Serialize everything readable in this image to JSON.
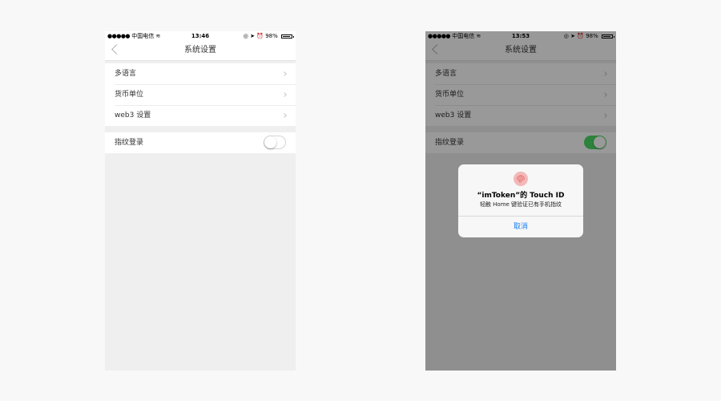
{
  "colors": {
    "page_bg": "#f8f8f8",
    "screen_bg": "#efefef",
    "toggle_on": "#4cd964",
    "ios_blue": "#1a7df1"
  },
  "left": {
    "status": {
      "carrier": "中国电信",
      "time": "13:46",
      "battery": "98%"
    },
    "nav_title": "系统设置",
    "settings": [
      {
        "label": "多语言"
      },
      {
        "label": "货币单位"
      },
      {
        "label": "web3 设置"
      }
    ],
    "fingerprint": {
      "label": "指纹登录",
      "enabled": false
    }
  },
  "right": {
    "status": {
      "carrier": "中国电信",
      "time": "13:53",
      "battery": "98%"
    },
    "nav_title": "系统设置",
    "settings": [
      {
        "label": "多语言"
      },
      {
        "label": "货币单位"
      },
      {
        "label": "web3 设置"
      }
    ],
    "fingerprint": {
      "label": "指纹登录",
      "enabled": true
    },
    "dialog": {
      "icon": "fingerprint-icon",
      "title": "“imToken”的 Touch ID",
      "message": "轻触 Home 键验证已有手机指纹",
      "cancel": "取消"
    }
  }
}
